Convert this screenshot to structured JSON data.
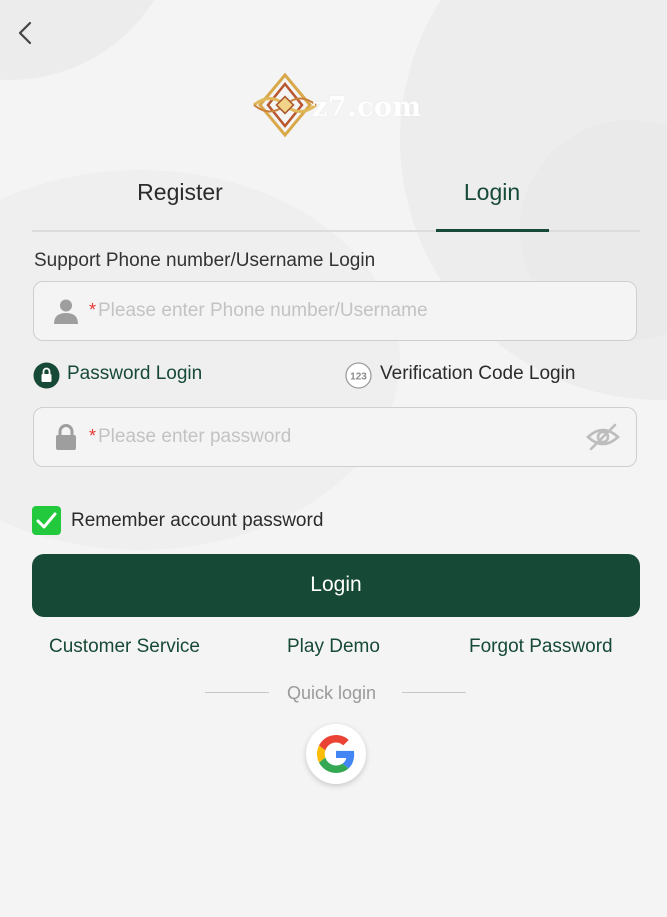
{
  "header": {
    "logo_text": "z7.com"
  },
  "tabs": [
    {
      "label": "Register",
      "active": false
    },
    {
      "label": "Login",
      "active": true
    }
  ],
  "form": {
    "account_label": "Support Phone number/Username Login",
    "required_mark": "*",
    "account_placeholder": "Please enter Phone number/Username",
    "password_placeholder": "Please enter password",
    "login_modes": [
      {
        "label": "Password Login",
        "active": true,
        "icon": "lock-icon"
      },
      {
        "label": "Verification Code Login",
        "active": false,
        "icon": "123-icon"
      }
    ],
    "remember_label": "Remember account password",
    "remember_checked": true,
    "submit_label": "Login"
  },
  "links": {
    "customer_service": "Customer Service",
    "play_demo": "Play Demo",
    "forgot_password": "Forgot Password"
  },
  "quick_login": {
    "label": "Quick login",
    "providers": [
      "google-icon"
    ]
  },
  "colors": {
    "brand_green": "#174a36",
    "checkbox_green": "#22c93d",
    "required_red": "#e53935",
    "background": "#f4f4f4"
  }
}
